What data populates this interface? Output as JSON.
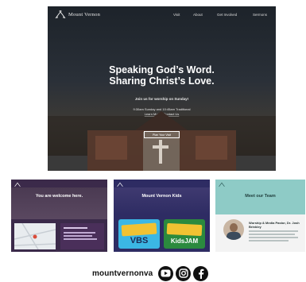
{
  "hero": {
    "logo_text": "Mount Vernon",
    "nav": [
      "Visit",
      "About",
      "Get Involved",
      "Sermons"
    ],
    "headline_1": "Speaking God’s Word.",
    "headline_2": "Sharing Christ’s Love.",
    "invite": "Join us for worship on Sunday!",
    "times_1": "9:30am Sunday and 10:45am Traditional",
    "times_2": "Learn More / Contact Us",
    "button_label": "Plan Your Visit"
  },
  "thumbnails": [
    {
      "title": "You are welcome here."
    },
    {
      "title": "Mount Vernon Kids",
      "badge_1": "VBS",
      "badge_2": "KidsJAM"
    },
    {
      "title": "Meet our Team",
      "subtitle": "Worship & Media Pastor, Dr. Josh Brinkley"
    }
  ],
  "social": {
    "handle": "mountvernonva",
    "icons": [
      "youtube-icon",
      "instagram-icon",
      "facebook-icon"
    ]
  },
  "colors": {
    "hero_bg": "#1d232a",
    "kids_blue": "#2e2c63",
    "vbs_yellow": "#f1c232",
    "teal_header": "#8ecbc6"
  }
}
